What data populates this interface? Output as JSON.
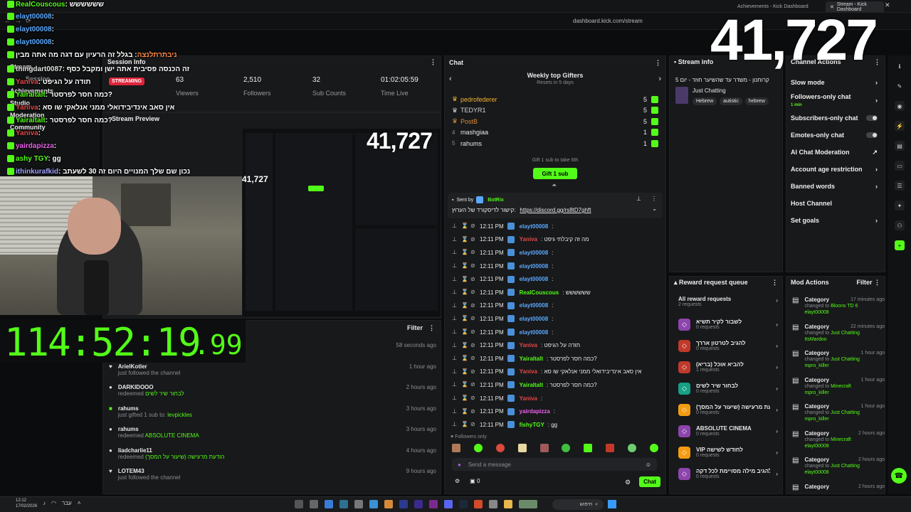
{
  "browser": {
    "tabs": [
      {
        "label": "Achievements - Kick Dashboard"
      },
      {
        "label": "Stream - Kick Dashboard"
      }
    ],
    "url": "dashboard.kick.com/stream"
  },
  "overlay": {
    "viewer_big": "41,727",
    "viewer_mid": "41,727",
    "viewer_small": "41,727",
    "timer_main": "114:52:19",
    "timer_frac": ".99",
    "chat": [
      {
        "user": "RealCouscous",
        "text": ": שששששש",
        "color": "#53fc18"
      },
      {
        "user": "elayt00008",
        "text": ":",
        "color": "#5aa9ff"
      },
      {
        "user": "elayt00008",
        "text": ":",
        "color": "#5aa9ff"
      },
      {
        "user": "elayt00008",
        "text": ":",
        "color": "#5aa9ff"
      },
      {
        "user": "ניבתרתלנצה",
        "text": ": בגלל זה הרעיון עם דגה מה אתה מבין",
        "color": "#ff8c42"
      },
      {
        "user": "thingdart0087",
        "text": ": זה הכנסה פסיבית אתה ישן ומקבל כסף",
        "color": "#e0e0e0"
      },
      {
        "user": "Yaniva",
        "text": ": תודה על הגיפט",
        "color": "#e04848"
      },
      {
        "user": "Yairaltalt",
        "text": ": כמה חסר לפרסטר?",
        "color": "#53fc18"
      },
      {
        "user": "Yaniva",
        "text": ": אין סאב אינדיבידואלי ממני אנלאקי שו סא",
        "color": "#e04848"
      },
      {
        "user": "Yairaltalt",
        "text": ": כמה חסר לפרסטר?",
        "color": "#53fc18"
      },
      {
        "user": "Yaniva",
        "text": ":",
        "color": "#e04848"
      },
      {
        "user": "yairdapizza",
        "text": ":",
        "color": "#e860e8"
      },
      {
        "user": "ashy TGY",
        "text": ": gg",
        "color": "#53fc18"
      },
      {
        "user": "ithinkurafkid",
        "text": ": נכון שם שלך המנויים היום זה 30 לשעתב",
        "color": "#a0a0ff"
      }
    ]
  },
  "sidebar": {
    "items": [
      {
        "label": "Stream"
      },
      {
        "label": "Session"
      },
      {
        "label": "Achievements"
      },
      {
        "label": "Studio"
      },
      {
        "label": "Moderation"
      },
      {
        "label": "Community"
      }
    ]
  },
  "session": {
    "title": "Session Info",
    "status": "STREAMING",
    "stats": [
      {
        "value": "63",
        "label": "Viewers"
      },
      {
        "value": "2,510",
        "label": "Followers"
      },
      {
        "value": "32",
        "label": "Sub Counts"
      },
      {
        "value": "01:02:05:59",
        "label": "Time Live"
      }
    ],
    "preview_title": "Stream Preview"
  },
  "feed": {
    "filter_label": "Filter",
    "items": [
      {
        "user": "",
        "detail": "",
        "time": "58 seconds ago"
      },
      {
        "user": "ArielKotler",
        "detail": "just followed the channel",
        "time": "1 hour ago"
      },
      {
        "user": "DARKIDOOO",
        "detail": "redeemed",
        "reward": "לבחור שיר לשים",
        "time": "2 hours ago"
      },
      {
        "user": "rahums",
        "detail": "just gifted 1 sub to:",
        "reward": "levpickles",
        "time": "3 hours ago"
      },
      {
        "user": "rahums",
        "detail": "redeemed",
        "reward": "ABSOLUTE CINEMA",
        "time": "3 hours ago"
      },
      {
        "user": "Iiadcharlie11",
        "detail": "redeemed",
        "reward": "הודעת מרעישה (שיעור על המסך)",
        "time": "4 hours ago"
      },
      {
        "user": "LOTEM43",
        "detail": "just followed the channel",
        "time": "9 hours ago"
      }
    ]
  },
  "chat": {
    "title": "Chat",
    "gifters_title": "Weekly top Gifters",
    "gifters_sub": "Resets in 5 days",
    "gifters": [
      {
        "rank": "1",
        "name": "pedrofederer",
        "count": "5",
        "color": "#f0b232"
      },
      {
        "rank": "2",
        "name": "TEDYR1",
        "count": "5",
        "color": "#cfd3d8"
      },
      {
        "rank": "3",
        "name": "PostB",
        "count": "5",
        "color": "#d98a3a"
      },
      {
        "rank": "4",
        "name": "mashgiaa",
        "count": "1",
        "color": "#e8e8e8"
      },
      {
        "rank": "5",
        "name": "rahums",
        "count": "1",
        "color": "#e8e8e8"
      }
    ],
    "gift_prompt": "Gift 1 sub to take 6th",
    "gift_button": "Gift 1 sub",
    "pinned_sender": "Sent by",
    "pinned_user": "BotRix",
    "pinned_text": "קישור לדיסקורד של הערוץ:",
    "pinned_link": "https://discord.gg/rs8tD7ghft",
    "messages": [
      {
        "time": "12:11 PM",
        "user": "elayt00008",
        "text": ":",
        "color": "#5aa9ff"
      },
      {
        "time": "12:11 PM",
        "user": "Yaniva",
        "text": ": מה זה קיבלתי גיפט",
        "color": "#e04848"
      },
      {
        "time": "12:11 PM",
        "user": "elayt00008",
        "text": ":",
        "color": "#5aa9ff"
      },
      {
        "time": "12:11 PM",
        "user": "elayt00008",
        "text": ":",
        "color": "#5aa9ff"
      },
      {
        "time": "12:11 PM",
        "user": "elayt00008",
        "text": ":",
        "color": "#5aa9ff"
      },
      {
        "time": "12:11 PM",
        "user": "RealCouscous",
        "text": ": שששששש",
        "color": "#53fc18"
      },
      {
        "time": "12:11 PM",
        "user": "elayt00008",
        "text": ":",
        "color": "#5aa9ff"
      },
      {
        "time": "12:11 PM",
        "user": "elayt00008",
        "text": ":",
        "color": "#5aa9ff"
      },
      {
        "time": "12:11 PM",
        "user": "elayt00008",
        "text": ":",
        "color": "#5aa9ff"
      },
      {
        "time": "12:11 PM",
        "user": "Yaniva",
        "text": ": תודה על הגיפט",
        "color": "#e04848"
      },
      {
        "time": "12:11 PM",
        "user": "Yairaltalt",
        "text": ": כמה חסר לפרסטר?",
        "color": "#53fc18"
      },
      {
        "time": "12:11 PM",
        "user": "Yaniva",
        "text": ": אין סאב אינדיבידואלי ממני אנלאקי שו סא",
        "color": "#e04848"
      },
      {
        "time": "12:11 PM",
        "user": "Yairaltalt",
        "text": ": כמה חסר לפרסטר?",
        "color": "#53fc18"
      },
      {
        "time": "12:11 PM",
        "user": "Yaniva",
        "text": ":",
        "color": "#e04848"
      },
      {
        "time": "12:11 PM",
        "user": "yairdapizza",
        "text": ":",
        "color": "#e860e8"
      },
      {
        "time": "12:11 PM",
        "user": "fishyTGY",
        "text": ": gg",
        "color": "#53fc18"
      }
    ],
    "followers_only": "Followers only",
    "input_placeholder": "Send a message",
    "points": "0",
    "send_label": "Chat"
  },
  "stream_info": {
    "title": "Stream info",
    "stream_title": "קרוחנון - משדר עד שהשיער חוזר - יום 5",
    "category": "Just Chatting",
    "tags": [
      "Hebrew",
      "autistic",
      "hebrew"
    ]
  },
  "channel_actions": {
    "title": "Channel Actions",
    "items": [
      {
        "label": "Slow mode",
        "kind": "arrow",
        "sub": ""
      },
      {
        "label": "Followers-only chat",
        "kind": "arrow",
        "sub": "1 min"
      },
      {
        "label": "Subscribers-only chat",
        "kind": "toggle",
        "sub": ""
      },
      {
        "label": "Emotes-only chat",
        "kind": "toggle",
        "sub": ""
      },
      {
        "label": "AI Chat Moderation",
        "kind": "ext",
        "sub": ""
      },
      {
        "label": "Account age restriction",
        "kind": "arrow",
        "sub": ""
      },
      {
        "label": "Banned words",
        "kind": "arrow",
        "sub": ""
      },
      {
        "label": "Host Channel",
        "kind": "none",
        "sub": ""
      },
      {
        "label": "Set goals",
        "kind": "arrow",
        "sub": ""
      }
    ]
  },
  "reward_queue": {
    "title": "Reward request queue",
    "all_label": "All reward requests",
    "all_count": "2 requests",
    "items": [
      {
        "name": "לשבור לקיר תשיא",
        "count": "0 requests",
        "color": "#8e44ad"
      },
      {
        "name": "להגיב לטרטון אררך",
        "count": "0 requests",
        "color": "#c0392b"
      },
      {
        "name": "להביא אוכל (בריא)",
        "count": "1 requests",
        "color": "#c0392b"
      },
      {
        "name": "לבחור שיר לשים",
        "count": "0 requests",
        "color": "#16a085"
      },
      {
        "name": "הודעת מרעישה (שיעור על המסך)",
        "count": "0 requests",
        "color": "#f39c12"
      },
      {
        "name": "ABSOLUTE CINEMA",
        "count": "0 requests",
        "color": "#8e44ad"
      },
      {
        "name": "VIP לחודש לשישה",
        "count": "0 requests",
        "color": "#f39c12"
      },
      {
        "name": "להגיב מילה מסויימת לכל דקה",
        "count": "0 requests",
        "color": "#8e44ad"
      }
    ]
  },
  "mod_actions": {
    "title": "Mod Actions",
    "filter_label": "Filter",
    "items": [
      {
        "label": "Category",
        "time": "17 minutes ago",
        "detail": "changed to",
        "value": "Bloons TD 6",
        "by": "elayt00008"
      },
      {
        "label": "Category",
        "time": "22 minutes ago",
        "detail": "changed to",
        "value": "Just Chatting",
        "by": "ItsMardoo"
      },
      {
        "label": "Category",
        "time": "1 hour ago",
        "detail": "changed to",
        "value": "Just Chatting",
        "by": "mpro_killer"
      },
      {
        "label": "Category",
        "time": "1 hour ago",
        "detail": "changed to",
        "value": "Minecraft",
        "by": "mpro_killer"
      },
      {
        "label": "Category",
        "time": "1 hour ago",
        "detail": "changed to",
        "value": "Just Chatting",
        "by": "mpro_killer"
      },
      {
        "label": "Category",
        "time": "2 hours ago",
        "detail": "changed to",
        "value": "Minecraft",
        "by": "elayt00008"
      },
      {
        "label": "Category",
        "time": "2 hours ago",
        "detail": "changed to",
        "value": "Just Chatting",
        "by": "elayt00008"
      },
      {
        "label": "Category",
        "time": "2 hours ago",
        "detail": "",
        "value": "",
        "by": ""
      }
    ]
  },
  "taskbar": {
    "time": "12:12",
    "date": "17/02/2026",
    "lang": "עבר",
    "search": "חיפוש"
  },
  "colors": {
    "accent": "#53fc18",
    "streaming": "#e0243b",
    "bg": "#0b0c0d",
    "panel": "#18191b"
  }
}
